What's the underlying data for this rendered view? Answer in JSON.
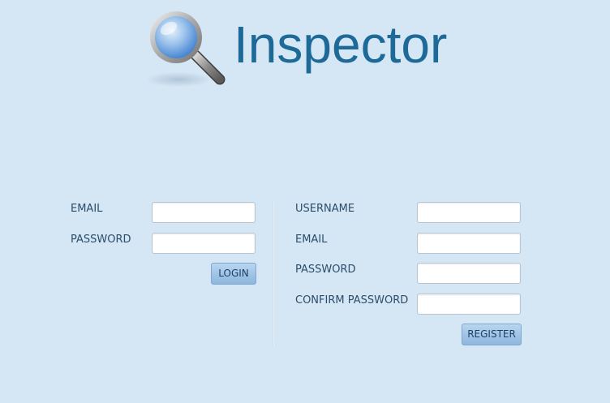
{
  "app": {
    "title": "Inspector"
  },
  "login": {
    "email_label": "EMAIL",
    "email_value": "",
    "password_label": "PASSWORD",
    "password_value": "",
    "submit_label": "LOGIN"
  },
  "register": {
    "username_label": "USERNAME",
    "username_value": "",
    "email_label": "EMAIL",
    "email_value": "",
    "password_label": "PASSWORD",
    "password_value": "",
    "confirm_label": "CONFIRM PASSWORD",
    "confirm_value": "",
    "submit_label": "REGISTER"
  },
  "icons": {
    "logo": "magnifying-glass-icon"
  },
  "colors": {
    "background": "#d5e6f4",
    "title": "#1d6a98",
    "label": "#2b4e6a",
    "button": "#9fc3e6"
  }
}
